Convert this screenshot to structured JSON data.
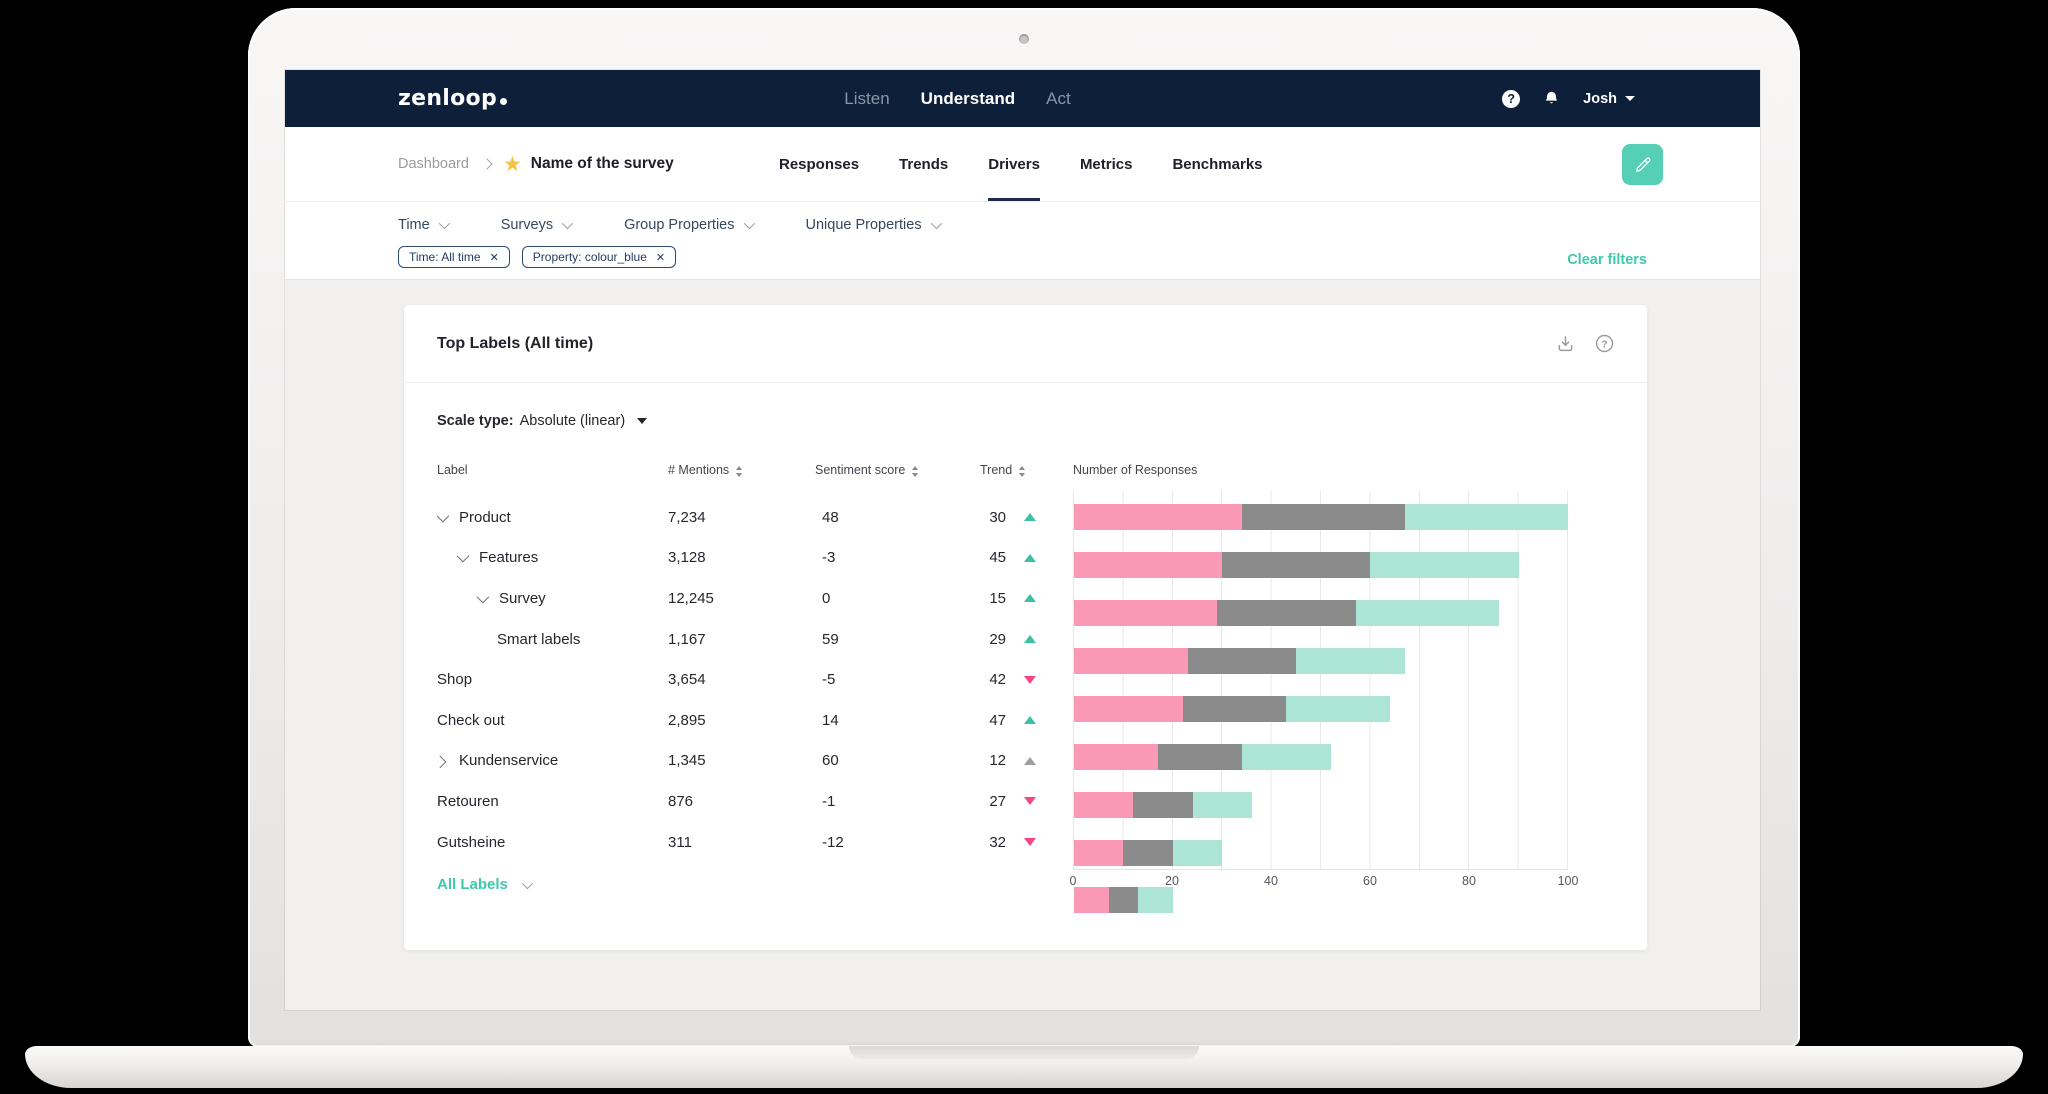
{
  "topbar": {
    "logo_text": "zenloop",
    "nav_items": [
      {
        "label": "Listen",
        "active": false
      },
      {
        "label": "Understand",
        "active": true
      },
      {
        "label": "Act",
        "active": false
      }
    ],
    "user_name": "Josh"
  },
  "header": {
    "breadcrumb": "Dashboard",
    "survey_title": "Name of the survey",
    "tabs": [
      {
        "label": "Responses",
        "active": false
      },
      {
        "label": "Trends",
        "active": false
      },
      {
        "label": "Drivers",
        "active": true
      },
      {
        "label": "Metrics",
        "active": false
      },
      {
        "label": "Benchmarks",
        "active": false
      }
    ]
  },
  "filters": {
    "dropdowns": [
      "Time",
      "Surveys",
      "Group Properties",
      "Unique Properties"
    ],
    "chips": [
      "Time: All time",
      "Property: colour_blue"
    ],
    "clear_label": "Clear filters"
  },
  "card": {
    "title": "Top Labels (All time)",
    "scale_type_label": "Scale type:",
    "scale_type_value": "Absolute (linear)",
    "footer_link": "All Labels"
  },
  "table": {
    "columns": [
      {
        "label": "Label",
        "sortable": false
      },
      {
        "label": "# Mentions",
        "sortable": true
      },
      {
        "label": "Sentiment score",
        "sortable": true
      },
      {
        "label": "Trend",
        "sortable": true
      }
    ],
    "chart_column_header": "Number of Responses",
    "rows": [
      {
        "label": "Product",
        "indent": 0,
        "chevron": "down",
        "mentions": "7,234",
        "sentiment": "48",
        "trend": "30",
        "trend_arrow": "up",
        "trend_arrow_color": "teal"
      },
      {
        "label": "Features",
        "indent": 1,
        "chevron": "down",
        "mentions": "3,128",
        "sentiment": "-3",
        "trend": "45",
        "trend_arrow": "up",
        "trend_arrow_color": "teal"
      },
      {
        "label": "Survey",
        "indent": 2,
        "chevron": "down",
        "mentions": "12,245",
        "sentiment": "0",
        "trend": "15",
        "trend_arrow": "up",
        "trend_arrow_color": "teal"
      },
      {
        "label": "Smart labels",
        "indent": 3,
        "chevron": "none",
        "mentions": "1,167",
        "sentiment": "59",
        "trend": "29",
        "trend_arrow": "up",
        "trend_arrow_color": "teal"
      },
      {
        "label": "Shop",
        "indent": 0,
        "chevron": "none",
        "mentions": "3,654",
        "sentiment": "-5",
        "trend": "42",
        "trend_arrow": "down",
        "trend_arrow_color": "pink"
      },
      {
        "label": "Check out",
        "indent": 0,
        "chevron": "none",
        "mentions": "2,895",
        "sentiment": "14",
        "trend": "47",
        "trend_arrow": "up",
        "trend_arrow_color": "teal"
      },
      {
        "label": "Kundenservice",
        "indent": 0,
        "chevron": "right",
        "mentions": "1,345",
        "sentiment": "60",
        "trend": "12",
        "trend_arrow": "up",
        "trend_arrow_color": "gray"
      },
      {
        "label": "Retouren",
        "indent": 0,
        "chevron": "none",
        "mentions": "876",
        "sentiment": "-1",
        "trend": "27",
        "trend_arrow": "down",
        "trend_arrow_color": "pink"
      },
      {
        "label": "Gutsheine",
        "indent": 0,
        "chevron": "none",
        "mentions": "311",
        "sentiment": "-12",
        "trend": "32",
        "trend_arrow": "down",
        "trend_arrow_color": "pink"
      }
    ]
  },
  "chart_data": {
    "type": "bar",
    "orientation": "horizontal",
    "stacked": true,
    "title": "Number of Responses",
    "categories": [
      "Product",
      "Features",
      "Survey",
      "Smart labels",
      "Shop",
      "Check out",
      "Kundenservice",
      "Retouren",
      "Gutsheine"
    ],
    "series": [
      {
        "name": "pink-segment",
        "color": "#FA99B5",
        "values": [
          34,
          30,
          29,
          23,
          22,
          17,
          12,
          10,
          7
        ]
      },
      {
        "name": "grey-segment",
        "color": "#8B8B8B",
        "values": [
          33,
          30,
          28,
          22,
          21,
          17,
          12,
          10,
          6
        ]
      },
      {
        "name": "teal-segment",
        "color": "#ACE5D6",
        "values": [
          33,
          30,
          29,
          22,
          21,
          18,
          12,
          10,
          7
        ]
      }
    ],
    "xlim": [
      0,
      100
    ],
    "x_ticks": [
      0,
      20,
      40,
      60,
      80,
      100
    ],
    "gridlines": "vertical every 10",
    "legend": "none"
  },
  "colors": {
    "accent_teal": "#44C9AE",
    "navy": "#0E1F3A",
    "trend_up": "#3BC2A4",
    "trend_down": "#F4477D",
    "trend_neutral": "#9CA0A3",
    "star_yellow": "#F5C242",
    "bar_pink": "#FA99B5",
    "bar_grey": "#8B8B8B",
    "bar_teal": "#ACE5D6"
  }
}
